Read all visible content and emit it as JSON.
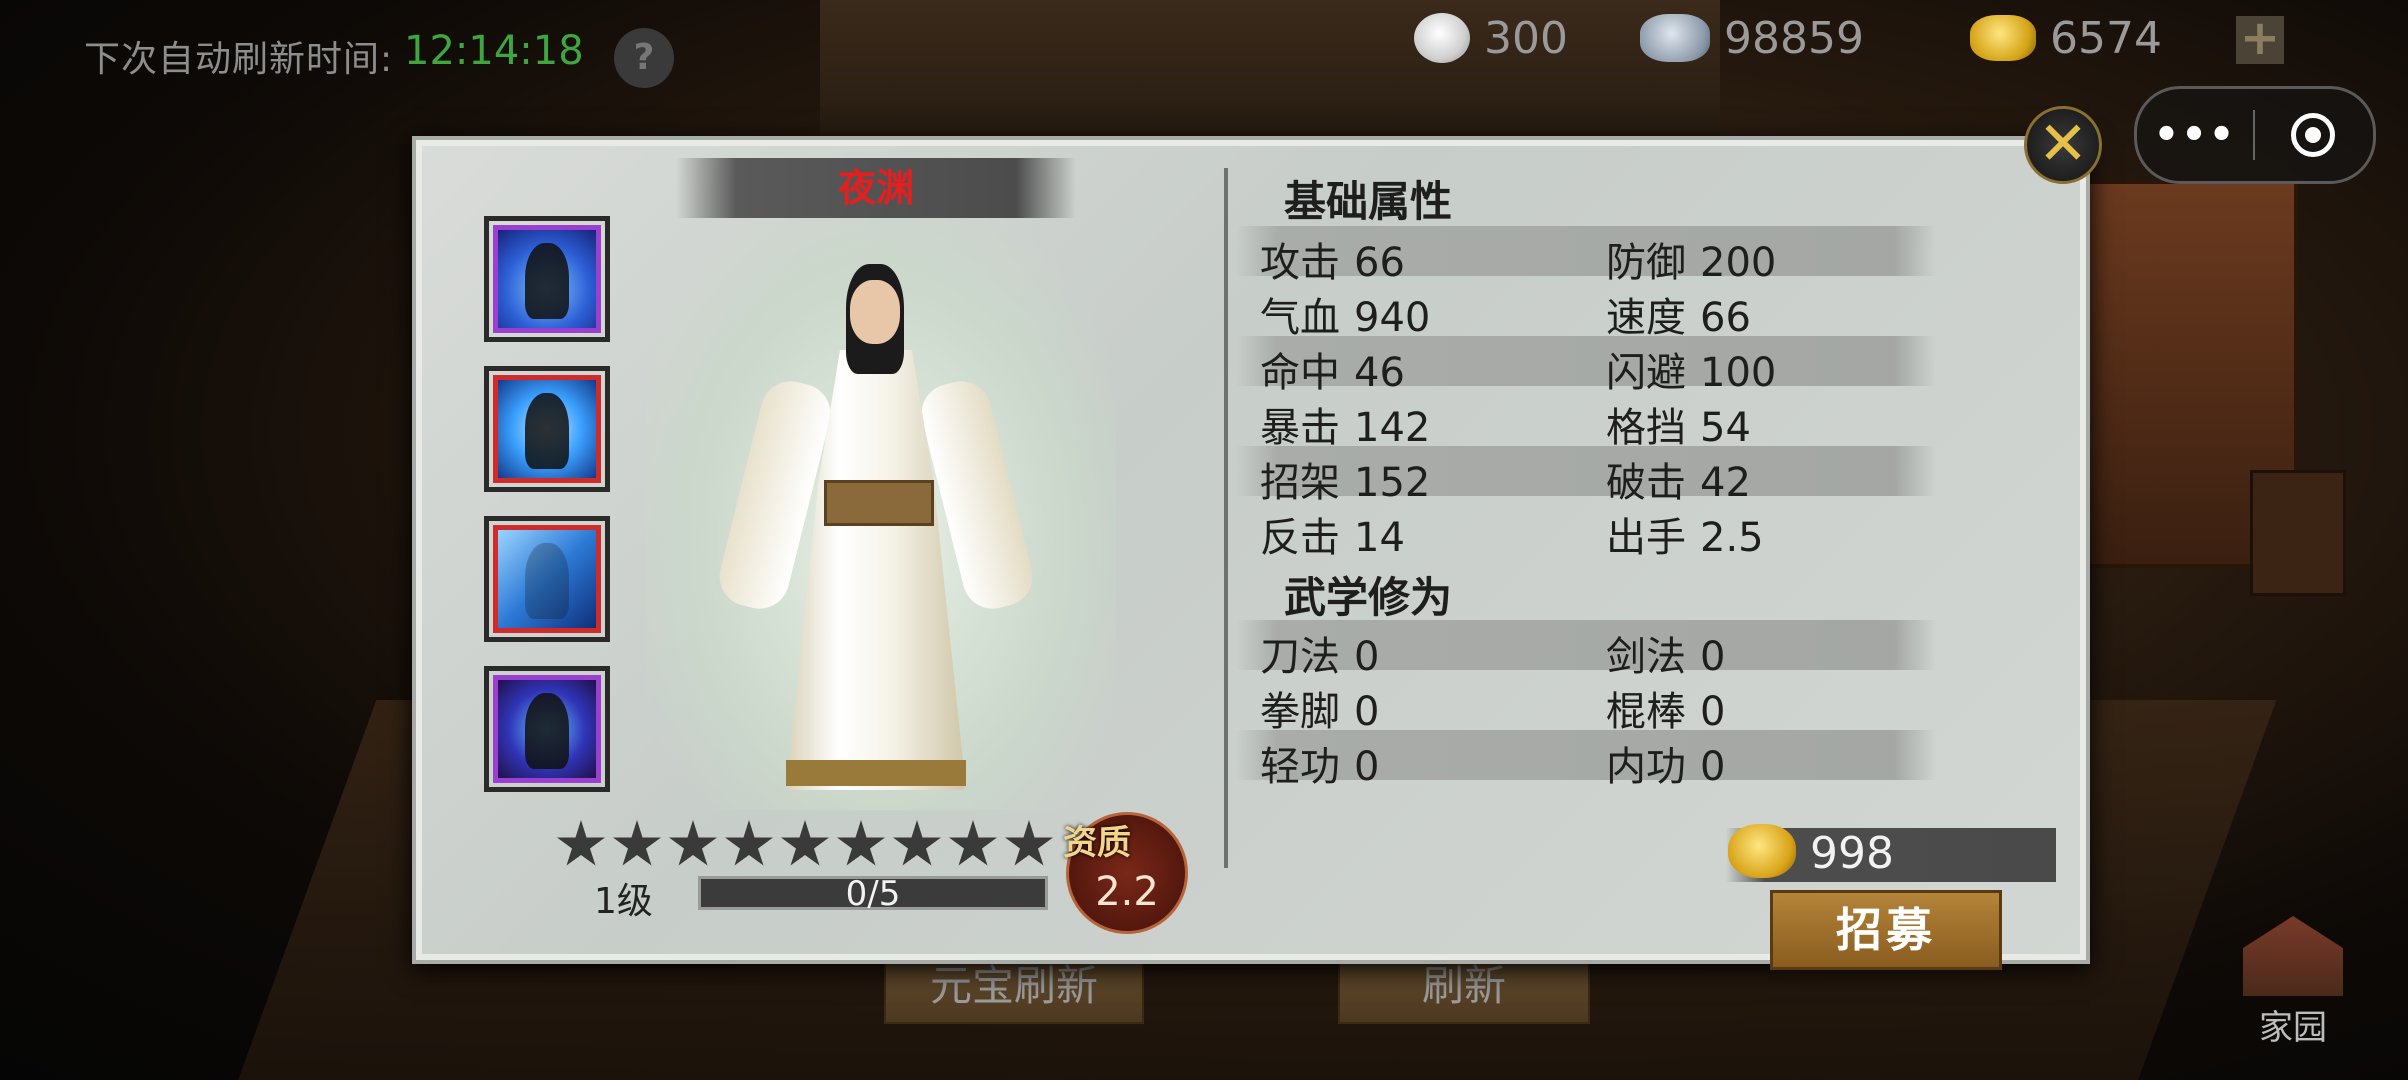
{
  "hud": {
    "refresh_label": "下次自动刷新时间:",
    "refresh_time": "12:14:18",
    "help_label": "?",
    "resources": [
      {
        "name": "bun",
        "icon": "steamed-bun-icon",
        "value": "300"
      },
      {
        "name": "silver",
        "icon": "silver-ingot-icon",
        "value": "98859"
      },
      {
        "name": "gold",
        "icon": "gold-ingot-icon",
        "value": "6574"
      }
    ],
    "plus_label": "+"
  },
  "capsule": {
    "more_label": "•••"
  },
  "hero": {
    "name": "夜渊",
    "name_color": "#e31f1f",
    "skills": [
      {
        "icon": "skill-1-icon",
        "frame_color": "#9b3fd1"
      },
      {
        "icon": "skill-2-icon",
        "frame_color": "#d12a2a"
      },
      {
        "icon": "skill-3-icon",
        "frame_color": "#d12a2a"
      },
      {
        "icon": "skill-4-icon",
        "frame_color": "#9b3fd1"
      }
    ],
    "stars_total": 9,
    "stars_filled": 0,
    "level": "1级",
    "exp_text": "0/5",
    "exp_fraction": 0,
    "aptitude_label": "资质",
    "aptitude_value": "2.2"
  },
  "attributes": {
    "basic_title": "基础属性",
    "basic": [
      [
        {
          "k": "攻击",
          "v": "66"
        },
        {
          "k": "防御",
          "v": "200"
        }
      ],
      [
        {
          "k": "气血",
          "v": "940"
        },
        {
          "k": "速度",
          "v": "66"
        }
      ],
      [
        {
          "k": "命中",
          "v": "46"
        },
        {
          "k": "闪避",
          "v": "100"
        }
      ],
      [
        {
          "k": "暴击",
          "v": "142"
        },
        {
          "k": "格挡",
          "v": "54"
        }
      ],
      [
        {
          "k": "招架",
          "v": "152"
        },
        {
          "k": "破击",
          "v": "42"
        }
      ],
      [
        {
          "k": "反击",
          "v": "14"
        },
        {
          "k": "出手",
          "v": "2.5"
        }
      ]
    ],
    "martial_title": "武学修为",
    "martial": [
      [
        {
          "k": "刀法",
          "v": "0"
        },
        {
          "k": "剑法",
          "v": "0"
        }
      ],
      [
        {
          "k": "拳脚",
          "v": "0"
        },
        {
          "k": "棍棒",
          "v": "0"
        }
      ],
      [
        {
          "k": "轻功",
          "v": "0"
        },
        {
          "k": "内功",
          "v": "0"
        }
      ]
    ]
  },
  "recruit": {
    "price": "998",
    "price_icon": "gold-ingot-icon",
    "button_label": "招募"
  },
  "background_buttons": {
    "yuanbao_refresh": "元宝刷新",
    "refresh": "刷新",
    "home": "家园"
  },
  "close_icon": "close-x-icon"
}
